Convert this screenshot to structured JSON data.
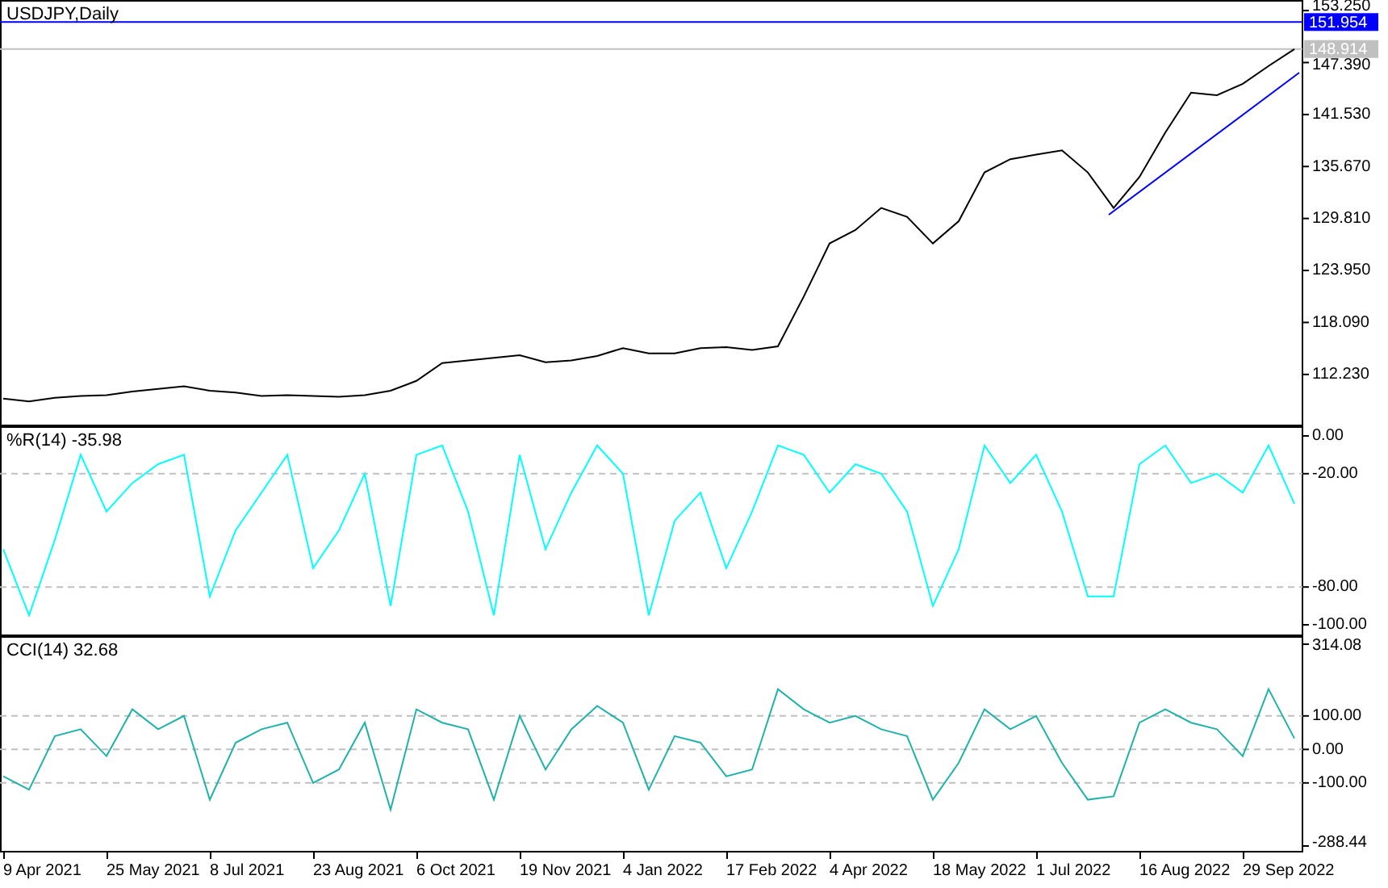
{
  "charts": [
    {
      "chart_data": {
        "type": "line",
        "title": "USDJPY,Daily",
        "series": [
          {
            "color": "#000000",
            "values": [
              109.5,
              109.2,
              109.6,
              109.8,
              109.9,
              110.3,
              110.6,
              110.9,
              110.4,
              110.2,
              109.8,
              109.9,
              109.8,
              109.7,
              109.9,
              110.4,
              111.5,
              113.5,
              113.8,
              114.1,
              114.4,
              113.6,
              113.8,
              114.3,
              115.2,
              114.6,
              114.6,
              115.2,
              115.3,
              115.0,
              115.4,
              121.0,
              127.0,
              128.5,
              131.0,
              130.0,
              127.0,
              129.5,
              135.0,
              136.5,
              137.0,
              137.5,
              135.0,
              131.0,
              134.5,
              139.5,
              144.0,
              143.7,
              145.0,
              147.0,
              148.9
            ]
          }
        ],
        "ylim": [
          106.39,
          154.44
        ],
        "yticks": [
          {
            "value": 153.25,
            "label": "153.250"
          },
          {
            "value": 147.39,
            "label": "147.390"
          },
          {
            "value": 141.53,
            "label": "141.530"
          },
          {
            "value": 135.67,
            "label": "135.670"
          },
          {
            "value": 129.81,
            "label": "129.810"
          },
          {
            "value": 123.95,
            "label": "123.950"
          },
          {
            "value": 118.09,
            "label": "118.090"
          },
          {
            "value": 112.23,
            "label": "112.230"
          }
        ],
        "ref_lines": [
          {
            "axis": "y",
            "value": 151.954,
            "label": "151.954",
            "color": "#0000ff"
          },
          {
            "axis": "y",
            "value": 148.914,
            "label": "148.914",
            "color": "#c0c0c0"
          }
        ]
      }
    },
    {
      "chart_data": {
        "type": "line",
        "title": "%R(14) -35.98",
        "grid": true,
        "series": [
          {
            "color": "#00ffff",
            "values": [
              -60,
              -95,
              -55,
              -10,
              -40,
              -25,
              -15,
              -10,
              -85,
              -50,
              -30,
              -10,
              -70,
              -50,
              -20,
              -90,
              -10,
              -5,
              -40,
              -95,
              -10,
              -60,
              -30,
              -5,
              -20,
              -95,
              -45,
              -30,
              -70,
              -40,
              -5,
              -10,
              -30,
              -15,
              -20,
              -40,
              -90,
              -60,
              -5,
              -25,
              -10,
              -40,
              -85,
              -85,
              -15,
              -5,
              -25,
              -20,
              -30,
              -5,
              -36
            ]
          }
        ],
        "ylim": [
          -106,
          5.13
        ],
        "yticks": [
          {
            "value": 0,
            "label": "0.00"
          },
          {
            "value": -20,
            "label": "-20.00"
          },
          {
            "value": -80,
            "label": "-80.00"
          },
          {
            "value": -100,
            "label": "-100.00"
          }
        ]
      }
    },
    {
      "chart_data": {
        "type": "line",
        "title": "CCI(14) 32.68",
        "grid": true,
        "series": [
          {
            "color": "#20b2aa",
            "values": [
              -80,
              -120,
              40,
              60,
              -20,
              120,
              60,
              100,
              -150,
              20,
              60,
              80,
              -100,
              -60,
              80,
              -180,
              120,
              80,
              60,
              -150,
              100,
              -60,
              60,
              130,
              80,
              -120,
              40,
              20,
              -80,
              -60,
              180,
              120,
              80,
              100,
              60,
              40,
              -150,
              -40,
              120,
              60,
              100,
              -40,
              -150,
              -140,
              80,
              120,
              80,
              60,
              -20,
              180,
              33
            ]
          }
        ],
        "ylim": [
          -307.7,
          338.2
        ],
        "yticks": [
          {
            "value": 314.08,
            "label": "314.08"
          },
          {
            "value": 100,
            "label": "100.00"
          },
          {
            "value": 0,
            "label": "0.00"
          },
          {
            "value": -100,
            "label": "-100.00"
          },
          {
            "value": -288.44,
            "label": "-288.44"
          }
        ]
      }
    }
  ],
  "time_axis": [
    "9 Apr 2021",
    "25 May 2021",
    "8 Jul 2021",
    "23 Aug 2021",
    "6 Oct 2021",
    "19 Nov 2021",
    "4 Jan 2022",
    "17 Feb 2022",
    "4 Apr 2022",
    "18 May 2022",
    "1 Jul 2022",
    "16 Aug 2022",
    "29 Sep 2022"
  ]
}
